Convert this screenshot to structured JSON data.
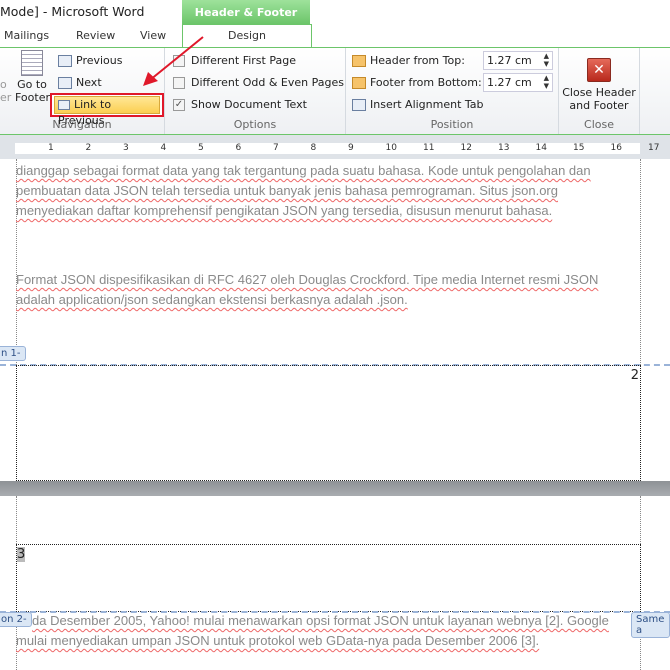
{
  "window": {
    "title": "Mode]  -  Microsoft Word"
  },
  "tabs": [
    "Mailings",
    "Review",
    "View"
  ],
  "context_tab": {
    "group": "Header & Footer Tools",
    "tab": "Design"
  },
  "ribbon": {
    "navigation": {
      "label": "Navigation",
      "go_to_footer": "Go to Footer",
      "go_to_footer_l1": "Go to",
      "go_to_footer_l2": "Footer",
      "cut_prev": "o",
      "cut_prev2": "er",
      "previous": "Previous",
      "next": "Next",
      "link_to_previous": "Link to Previous"
    },
    "options": {
      "label": "Options",
      "items": [
        {
          "label": "Different First Page",
          "checked": false
        },
        {
          "label": "Different Odd & Even Pages",
          "checked": false
        },
        {
          "label": "Show Document Text",
          "checked": true
        }
      ]
    },
    "position": {
      "label": "Position",
      "header_from_top": "Header from Top:",
      "header_value": "1.27 cm",
      "footer_from_bottom": "Footer from Bottom:",
      "footer_value": "1.27 cm",
      "insert_alignment_tab": "Insert Alignment Tab"
    },
    "close": {
      "label": "Close",
      "button_l1": "Close Header",
      "button_l2": "and Footer"
    }
  },
  "ruler": [
    "1",
    "2",
    "3",
    "4",
    "5",
    "6",
    "7",
    "8",
    "9",
    "10",
    "11",
    "12",
    "13",
    "14",
    "15",
    "16",
    "17"
  ],
  "document": {
    "para1": [
      "dianggap sebagai format data yang tak tergantung pada suatu bahasa. Kode untuk pengolahan dan",
      "pembuatan data JSON telah tersedia untuk banyak jenis bahasa pemrograman. Situs json.org",
      "menyediakan daftar komprehensif pengikatan JSON yang tersedia, disusun menurut bahasa."
    ],
    "para2": [
      "Format JSON dispesifikasikan di RFC 4627  oleh Douglas Crockford. Tipe media Internet resmi JSON",
      "adalah application/json sedangkan ekstensi berkasnya adalah .json."
    ],
    "section1_tab": "n 1-",
    "footer_page_number": "2",
    "header_page_number": "3",
    "section2_tab": "on 2-",
    "same_as_previous_tab": "Same a",
    "para3": [
      "da Desember 2005, Yahoo! mulai menawarkan opsi format JSON untuk layanan webnya [2]. Google",
      "mulai menyediakan umpan JSON untuk protokol web GData-nya pada Desember 2006 [3]."
    ]
  },
  "colors": {
    "context_green": "#6cc56a",
    "highlight": "#fbcf52",
    "annotation_red": "#e0182a"
  }
}
